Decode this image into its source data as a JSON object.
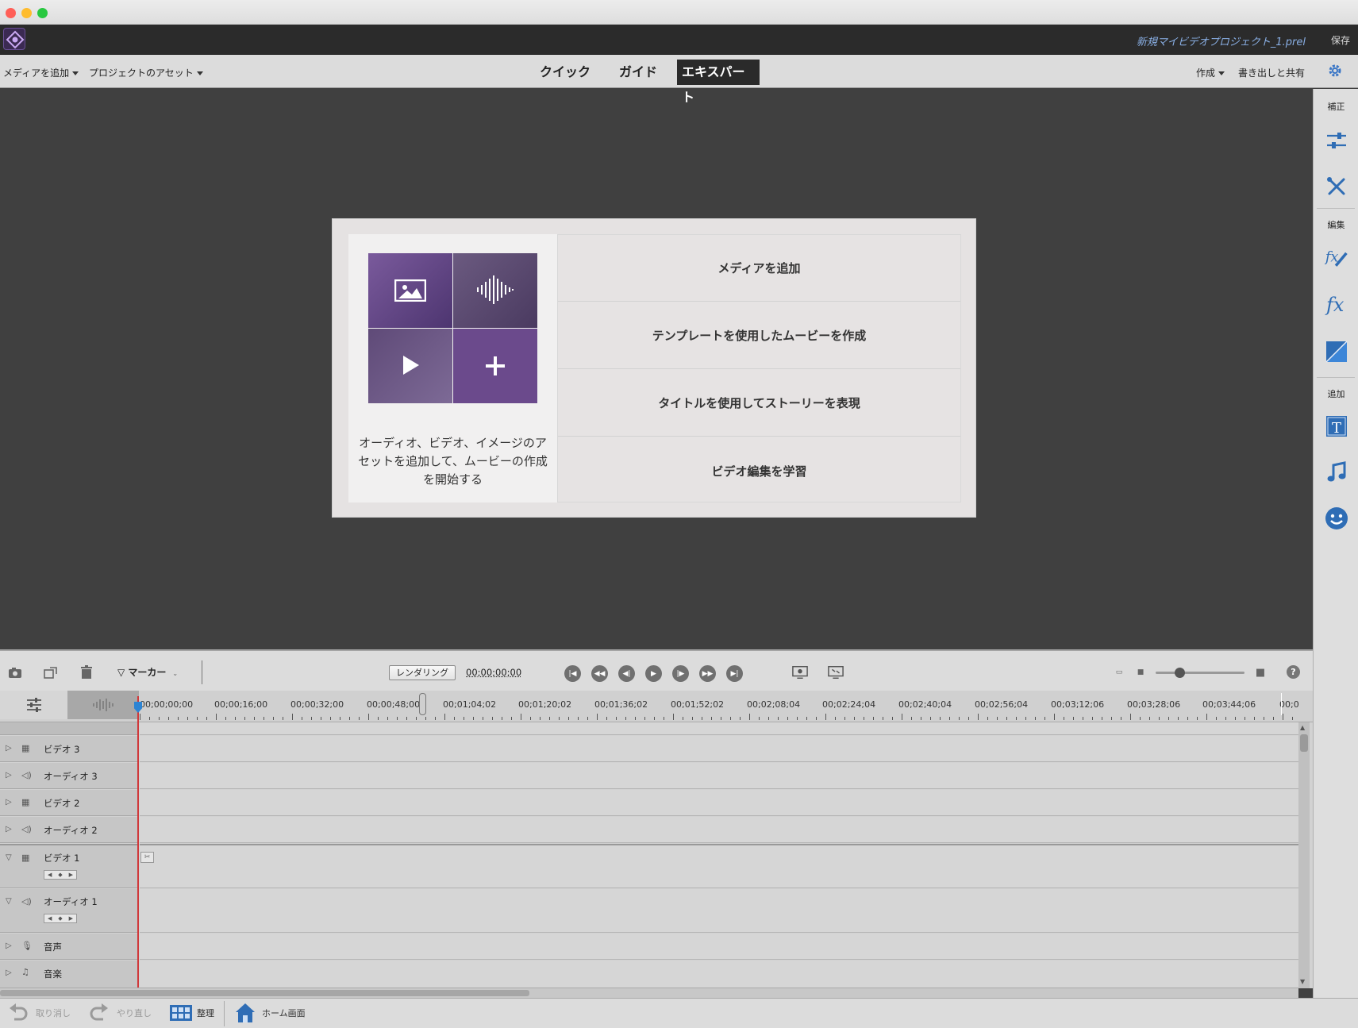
{
  "window": {
    "traffic_lights": [
      "#ff5f57",
      "#febc2e",
      "#28c840"
    ]
  },
  "header": {
    "project_name": "新規マイビデオプロジェクト_1.prel",
    "save": "保存"
  },
  "menubar": {
    "add_media": "メディアを追加",
    "project_assets": "プロジェクトのアセット",
    "tabs": [
      "クイック",
      "ガイド",
      "エキスパート"
    ],
    "active_tab": "エキスパート",
    "create": "作成",
    "export_share": "書き出しと共有"
  },
  "right_panel": {
    "section_adjust": "補正",
    "section_edit": "編集",
    "section_add": "追加",
    "icons": [
      "adjust-sliders-icon",
      "tools-icon",
      "applied-effects-icon",
      "fx-effects-icon",
      "transitions-icon",
      "title-icon",
      "music-note-icon",
      "graphics-smiley-icon"
    ],
    "accent": "#2f6db5"
  },
  "welcome": {
    "description": "オーディオ、ビデオ、イメージのアセットを追加して、ムービーの作成を開始する",
    "options": [
      "メディアを追加",
      "テンプレートを使用したムービーを作成",
      "タイトルを使用してストーリーを表現",
      "ビデオ編集を学習"
    ],
    "tile_color": "#6b4a8c"
  },
  "timeline_toolbar": {
    "marker": "マーカー",
    "render": "レンダリング",
    "timecode": "00;00;00;00"
  },
  "ruler": {
    "ticks": [
      "00;00;00;00",
      "00;00;16;00",
      "00;00;32;00",
      "00;00;48;00",
      "00;01;04;02",
      "00;01;20;02",
      "00;01;36;02",
      "00;01;52;02",
      "00;02;08;04",
      "00;02;24;04",
      "00;02;40;04",
      "00;02;56;04",
      "00;03;12;06",
      "00;03;28;06",
      "00;03;44;06",
      "00;0"
    ]
  },
  "tracks": [
    {
      "name": "ビデオ 3",
      "kind": "video",
      "expanded": false
    },
    {
      "name": "オーディオ 3",
      "kind": "audio",
      "expanded": false
    },
    {
      "name": "ビデオ 2",
      "kind": "video",
      "expanded": false
    },
    {
      "name": "オーディオ 2",
      "kind": "audio",
      "expanded": false
    },
    {
      "name": "ビデオ 1",
      "kind": "video",
      "expanded": true
    },
    {
      "name": "オーディオ 1",
      "kind": "audio",
      "expanded": true
    },
    {
      "name": "音声",
      "kind": "narration",
      "expanded": false
    },
    {
      "name": "音楽",
      "kind": "music",
      "expanded": false
    }
  ],
  "bottom_bar": {
    "undo": "取り消し",
    "redo": "やり直し",
    "organize": "整理",
    "home": "ホーム画面"
  }
}
